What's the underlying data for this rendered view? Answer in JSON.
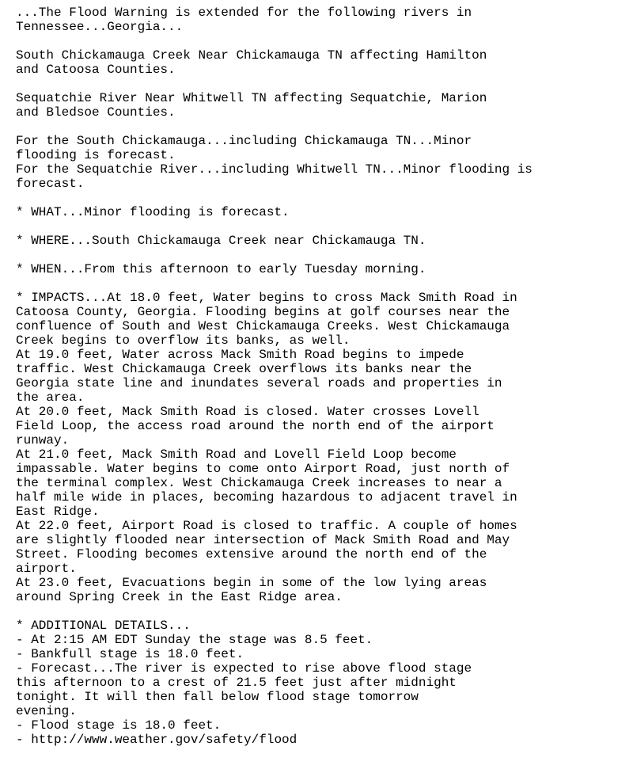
{
  "header": [
    "...The Flood Warning is extended for the following rivers in",
    "Tennessee...Georgia..."
  ],
  "affected": [
    [
      "South Chickamauga Creek Near Chickamauga TN affecting Hamilton",
      "and Catoosa Counties."
    ],
    [
      "Sequatchie River Near Whitwell TN affecting Sequatchie, Marion",
      "and Bledsoe Counties."
    ]
  ],
  "forecast_summary": [
    "For the South Chickamauga...including Chickamauga TN...Minor",
    "flooding is forecast.",
    "For the Sequatchie River...including Whitwell TN...Minor flooding is",
    "forecast."
  ],
  "what": "* WHAT...Minor flooding is forecast.",
  "where": "* WHERE...South Chickamauga Creek near Chickamauga TN.",
  "when": "* WHEN...From this afternoon to early Tuesday morning.",
  "impacts": [
    "* IMPACTS...At 18.0 feet, Water begins to cross Mack Smith Road in",
    "Catoosa County, Georgia. Flooding begins at golf courses near the",
    "confluence of South and West Chickamauga Creeks. West Chickamauga",
    "Creek begins to overflow its banks, as well.",
    "At 19.0 feet, Water across Mack Smith Road begins to impede",
    "traffic. West Chickamauga Creek overflows its banks near the",
    "Georgia state line and inundates several roads and properties in",
    "the area.",
    "At 20.0 feet, Mack Smith Road is closed. Water crosses Lovell",
    "Field Loop, the access road around the north end of the airport",
    "runway.",
    "At 21.0 feet, Mack Smith Road and Lovell Field Loop become",
    "impassable. Water begins to come onto Airport Road, just north of",
    "the terminal complex. West Chickamauga Creek increases to near a",
    "half mile wide in places, becoming hazardous to adjacent travel in",
    "East Ridge.",
    "At 22.0 feet, Airport Road is closed to traffic. A couple of homes",
    "are slightly flooded near intersection of Mack Smith Road and May",
    "Street. Flooding becomes extensive around the north end of the",
    "airport.",
    "At 23.0 feet, Evacuations begin in some of the low lying areas",
    "around Spring Creek in the East Ridge area."
  ],
  "additional_details": {
    "heading": "* ADDITIONAL DETAILS...",
    "observed": "- At 2:15 AM EDT Sunday the stage was 8.5 feet.",
    "bankfull": "- Bankfull stage is 18.0 feet.",
    "forecast": [
      "- Forecast...The river is expected to rise above flood stage",
      "this afternoon to a crest of 21.5 feet just after midnight",
      "tonight. It will then fall below flood stage tomorrow",
      "evening."
    ],
    "flood_stage": "- Flood stage is 18.0 feet.",
    "link": "- http://www.weather.gov/safety/flood"
  }
}
